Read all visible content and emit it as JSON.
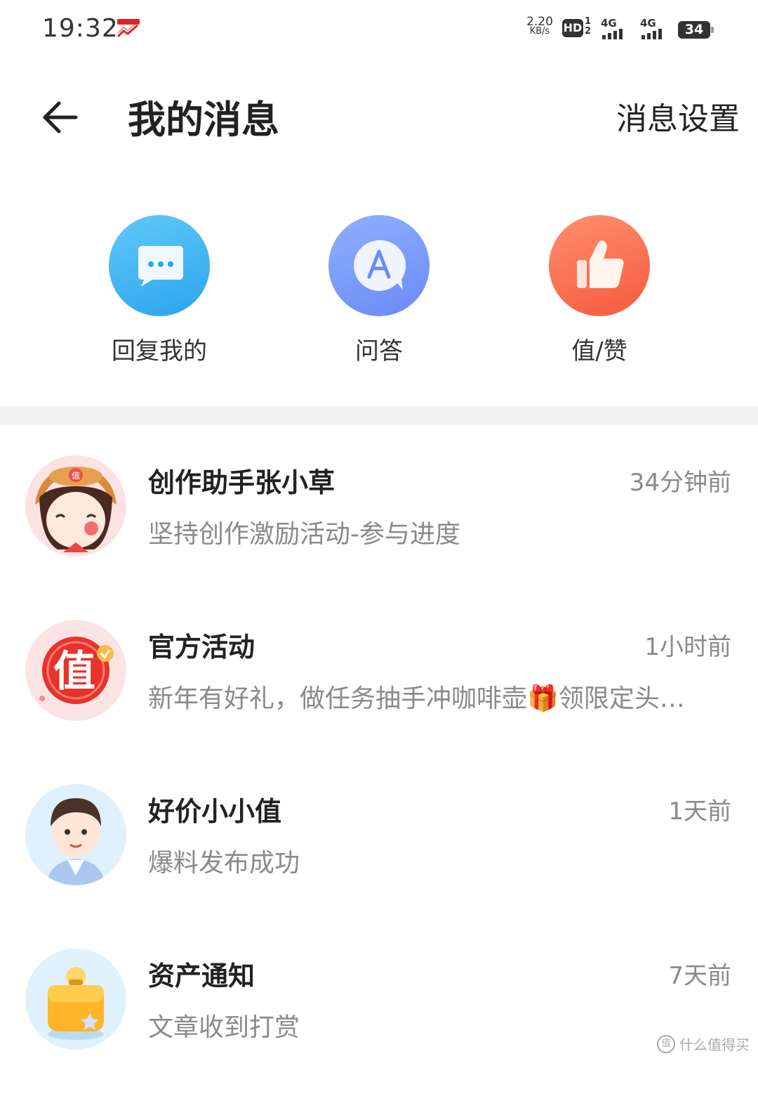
{
  "status_bar": {
    "time": "19:32",
    "net_speed_value": "2.20",
    "net_speed_unit": "KB/s",
    "hd_label": "HD",
    "hd_sims": "1\n2",
    "signal1_label": "4G",
    "signal2_label": "4G",
    "battery": "34"
  },
  "header": {
    "title": "我的消息",
    "settings_label": "消息设置"
  },
  "categories": [
    {
      "label": "回复我的",
      "icon": "chat-bubble-icon"
    },
    {
      "label": "问答",
      "icon": "qa-bubble-icon"
    },
    {
      "label": "值/赞",
      "icon": "thumbs-up-icon"
    }
  ],
  "messages": [
    {
      "title": "创作助手张小草",
      "time": "34分钟前",
      "preview": "坚持创作激励活动-参与进度",
      "avatar": "girl-hat-avatar"
    },
    {
      "title": "官方活动",
      "time": "1小时前",
      "preview": "新年有好礼，做任务抽手冲咖啡壶🎁领限定头…",
      "avatar": "zhi-badge-avatar"
    },
    {
      "title": "好价小小值",
      "time": "1天前",
      "preview": "爆料发布成功",
      "avatar": "boy-avatar"
    },
    {
      "title": "资产通知",
      "time": "7天前",
      "preview": "文章收到打赏",
      "avatar": "treasure-box-avatar"
    }
  ],
  "avatar_texts": {
    "hat_char": "值",
    "badge_char": "值"
  },
  "watermark": {
    "text": "什么值得买",
    "icon_char": "值"
  },
  "colors": {
    "reply_blue": "#2aa4ef",
    "qa_blue": "#6a8af7",
    "like_orange": "#f45a3c",
    "muted_text": "#8a8a8a"
  }
}
